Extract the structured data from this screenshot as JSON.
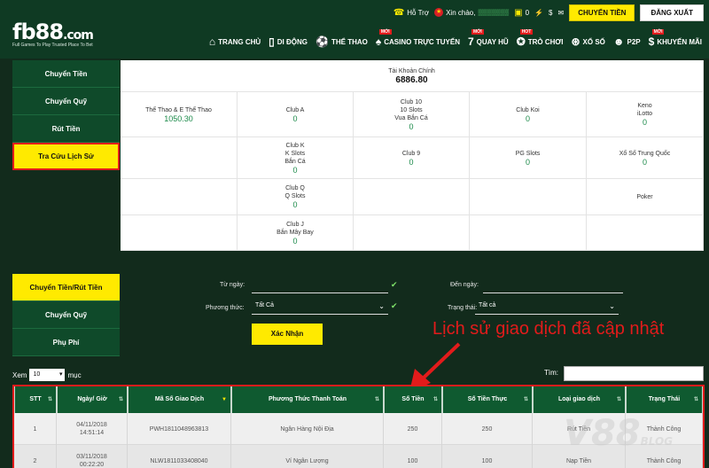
{
  "brand": {
    "logo_main": "fb88",
    "logo_dot": ".com",
    "logo_sub": "Full Games To Play    Trusted Place To Bet"
  },
  "topbar": {
    "support": "Hỗ Trợ",
    "greeting": "Xin chào,",
    "username": "▒▒▒▒▒▒▒",
    "balance": "0",
    "transfer_label": "CHUYỂN TIỀN",
    "logout_label": "ĐĂNG XUẤT"
  },
  "nav": [
    {
      "label": "TRANG CHỦ",
      "icon": "home-icon",
      "glyph": "⌂",
      "badge": ""
    },
    {
      "label": "DI ĐỘNG",
      "icon": "mobile-icon",
      "glyph": "▯",
      "badge": ""
    },
    {
      "label": "THỂ THAO",
      "icon": "soccer-icon",
      "glyph": "⚽",
      "badge": ""
    },
    {
      "label": "CASINO TRỰC TUYẾN",
      "icon": "casino-icon",
      "glyph": "♠",
      "badge": "MỚI"
    },
    {
      "label": "QUAY HŨ",
      "icon": "slot-icon",
      "glyph": "7",
      "badge": "MỚI"
    },
    {
      "label": "TRÒ CHƠI",
      "icon": "game-icon",
      "glyph": "✪",
      "badge": "HOT"
    },
    {
      "label": "XỔ SỐ",
      "icon": "lottery-icon",
      "glyph": "⊛",
      "badge": ""
    },
    {
      "label": "P2P",
      "icon": "p2p-icon",
      "glyph": "☻",
      "badge": ""
    },
    {
      "label": "KHUYẾN MÃI",
      "icon": "promo-icon",
      "glyph": "$",
      "badge": "MỚI"
    }
  ],
  "sidebar_top": [
    "Chuyển Tiền",
    "Chuyển Quỹ",
    "Rút Tiền",
    "Tra Cứu Lịch Sử"
  ],
  "sidebar_bottom": [
    "Chuyển Tiền/Rút Tiền",
    "Chuyển Quỹ",
    "Phụ Phí"
  ],
  "balances": {
    "main_label": "Tài Khoản Chính",
    "main_value": "6886.80",
    "cells": [
      {
        "label": "Thể Thao & E Thể Thao",
        "value": "1050.30"
      },
      {
        "label": "Club A",
        "value": "0"
      },
      {
        "label": "Club 10\n10 Slots\nVua Bắn Cá",
        "value": "0"
      },
      {
        "label": "Club Koi",
        "value": "0"
      },
      {
        "label": "Keno\niLotto",
        "value": "0"
      },
      {
        "label": "Club K\nK Slots\nBắn Cá",
        "value": "0"
      },
      {
        "label": "Club 9",
        "value": "0"
      },
      {
        "label": "PG Slots",
        "value": "0"
      },
      {
        "label": "Xổ Số Trung Quốc",
        "value": "0"
      },
      {
        "label": "Club Q\nQ Slots",
        "value": "0"
      },
      {
        "label": "Poker",
        "value": ""
      },
      {
        "label": "Club J\nBắn Mây Bay",
        "value": "0"
      }
    ]
  },
  "filters": {
    "from_label": "Từ ngày:",
    "to_label": "Đến ngày:",
    "method_label": "Phương thức:",
    "method_value": "Tất Cả",
    "status_label": "Trạng thái:",
    "status_value": "Tất cả",
    "confirm_label": "Xác Nhận"
  },
  "annotation": "Lịch sử giao dịch đã cập nhật",
  "table_controls": {
    "show_label": "Xem",
    "page_size": "10",
    "entries_label": "mục",
    "search_label": "Tìm:"
  },
  "table": {
    "headers": [
      "STT",
      "Ngày/ Giờ",
      "Mã Số Giao Dịch",
      "Phương Thức Thanh Toán",
      "Số Tiền",
      "Số Tiền Thực",
      "Loại giao dịch",
      "Trạng Thái"
    ],
    "rows": [
      [
        "1",
        "04/11/2018\n14:51:14",
        "PWH1811048963813",
        "Ngân Hàng Nội Địa",
        "250",
        "250",
        "Rút Tiền",
        "Thành Công"
      ],
      [
        "2",
        "03/11/2018\n00:22:20",
        "NLW1811033408040",
        "Ví Ngân Lượng",
        "100",
        "100",
        "Nạp Tiền",
        "Thành Công"
      ]
    ]
  },
  "watermark": {
    "main": "V88",
    "sub": "BLOG"
  },
  "colors": {
    "accent": "#ffea00",
    "header": "#0f3a23",
    "annotation": "#e21b1b"
  }
}
